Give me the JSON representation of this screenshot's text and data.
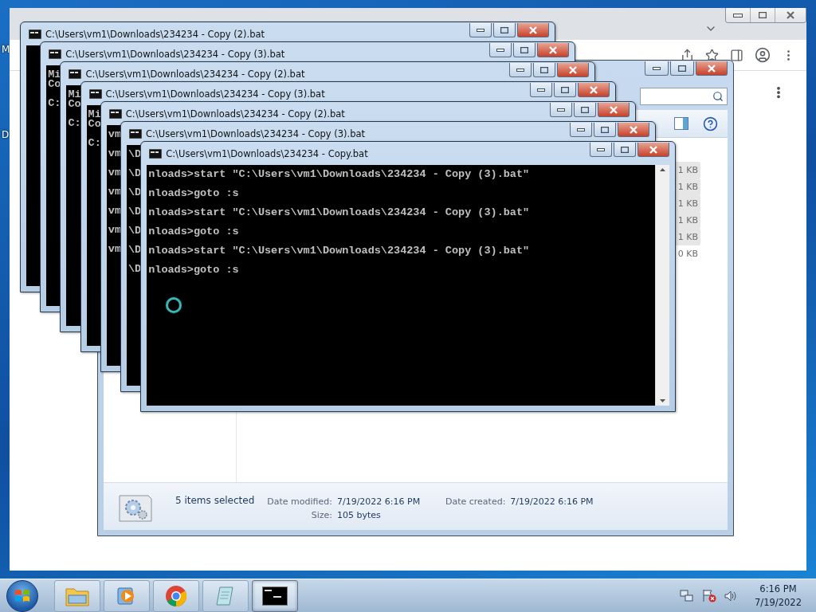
{
  "desktop": {
    "icon_labels": [
      {
        "text": "M"
      },
      {
        "text": "D"
      }
    ]
  },
  "explorer": {
    "files": [
      {
        "size": "1 KB",
        "selected": true
      },
      {
        "size": "1 KB",
        "selected": true
      },
      {
        "size": "1 KB",
        "selected": true
      },
      {
        "size": "1 KB",
        "selected": true
      },
      {
        "size": "1 KB",
        "selected": true
      },
      {
        "size": "0 KB",
        "selected": false
      }
    ],
    "status": {
      "summary": "5 items selected",
      "fields": [
        {
          "label": "Date modified:",
          "value": "7/19/2022 6:16 PM"
        },
        {
          "label": "Date created:",
          "value": "7/19/2022 6:16 PM"
        },
        {
          "label": "Size:",
          "value": "105 bytes"
        }
      ]
    }
  },
  "consoles": [
    {
      "title": "C:\\Users\\vm1\\Downloads\\234234 - Copy (2).bat"
    },
    {
      "title": "C:\\Users\\vm1\\Downloads\\234234 - Copy (3).bat",
      "lines": [
        {
          "kind": "banner",
          "text": "Mi"
        },
        {
          "kind": "banner",
          "text": "Co"
        },
        {
          "kind": "prompt",
          "text": "C:"
        }
      ]
    },
    {
      "title": "C:\\Users\\vm1\\Downloads\\234234 - Copy (2).bat",
      "lines": [
        {
          "kind": "banner",
          "text": "Mi"
        },
        {
          "kind": "banner",
          "text": "Co"
        },
        {
          "kind": "prompt",
          "text": "C:"
        }
      ]
    },
    {
      "title": "C:\\Users\\vm1\\Downloads\\234234 - Copy (3).bat",
      "lines": [
        {
          "kind": "banner",
          "text": "Mi"
        },
        {
          "kind": "banner",
          "text": "Co"
        },
        {
          "kind": "prompt",
          "text": "C:"
        }
      ]
    },
    {
      "title": "C:\\Users\\vm1\\Downloads\\234234 - Copy (2).bat",
      "lines": [
        {
          "kind": "prompt",
          "text": "vm"
        },
        {
          "kind": "prompt",
          "text": "vm"
        },
        {
          "kind": "prompt",
          "text": "vm"
        },
        {
          "kind": "prompt",
          "text": "vm"
        },
        {
          "kind": "prompt",
          "text": "vm"
        },
        {
          "kind": "prompt",
          "text": "vm"
        },
        {
          "kind": "prompt",
          "text": "vm"
        }
      ]
    },
    {
      "title": "C:\\Users\\vm1\\Downloads\\234234 - Copy (3).bat",
      "lines": [
        {
          "kind": "prompt",
          "text": "\\D"
        },
        {
          "kind": "prompt",
          "text": "\\D"
        },
        {
          "kind": "prompt",
          "text": "\\D"
        },
        {
          "kind": "prompt",
          "text": "\\D"
        },
        {
          "kind": "prompt",
          "text": "\\D"
        },
        {
          "kind": "prompt",
          "text": "\\D"
        },
        {
          "kind": "prompt",
          "text": "\\D"
        }
      ]
    },
    {
      "title": "C:\\Users\\vm1\\Downloads\\234234 - Copy.bat",
      "lines": [
        {
          "kind": "prompt",
          "text": "nloads>start \"C:\\Users\\vm1\\Downloads\\234234 - Copy (3).bat\""
        },
        {
          "kind": "prompt",
          "text": "nloads>goto :s"
        },
        {
          "kind": "prompt",
          "text": "nloads>start \"C:\\Users\\vm1\\Downloads\\234234 - Copy (3).bat\""
        },
        {
          "kind": "prompt",
          "text": "nloads>goto :s"
        },
        {
          "kind": "prompt",
          "text": "nloads>start \"C:\\Users\\vm1\\Downloads\\234234 - Copy (3).bat\""
        },
        {
          "kind": "prompt",
          "text": "nloads>goto :s"
        }
      ]
    }
  ],
  "taskbar": {
    "apps": [
      {
        "kind": "explorer",
        "active": false
      },
      {
        "kind": "media",
        "active": false
      },
      {
        "kind": "chrome",
        "active": false
      },
      {
        "kind": "notepad",
        "active": false
      },
      {
        "kind": "cmd",
        "active": true
      }
    ],
    "clock": {
      "time": "6:16 PM",
      "date": "7/19/2022"
    }
  }
}
